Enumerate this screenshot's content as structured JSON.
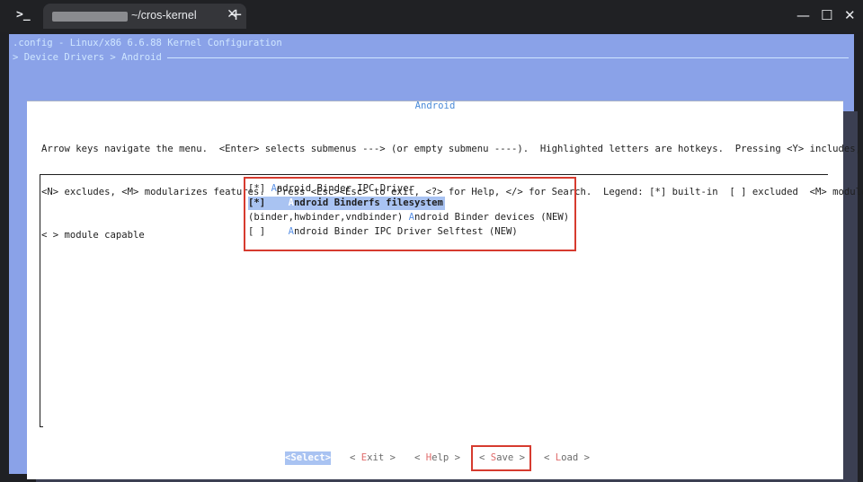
{
  "window": {
    "tab_title": "~/cros-kernel",
    "tab_close_glyph": "✕",
    "new_tab_glyph": "+",
    "prompt_glyph": ">_",
    "minimize_glyph": "—",
    "maximize_glyph": "☐",
    "close_glyph": "✕"
  },
  "header": {
    "config_line": ".config - Linux/x86 6.6.88 Kernel Configuration",
    "breadcrumb": "> Device Drivers > Android"
  },
  "dialog": {
    "title": "Android",
    "help_lines": [
      "Arrow keys navigate the menu.  <Enter> selects submenus ---> (or empty submenu ----).  Highlighted letters are hotkeys.  Pressing <Y> includes,",
      "<N> excludes, <M> modularizes features.  Press <Esc><Esc> to exit, <?> for Help, </> for Search.  Legend: [*] built-in  [ ] excluded  <M> module",
      "< > module capable"
    ]
  },
  "menu": {
    "items": [
      {
        "prefix": "[*] ",
        "hotkey": "A",
        "rest": "ndroid Binder IPC Driver",
        "selected": false
      },
      {
        "prefix": "[*]    ",
        "hotkey": "A",
        "rest": "ndroid Binderfs filesystem",
        "selected": true
      },
      {
        "prefix": "(binder,hwbinder,vndbinder) ",
        "hotkey": "A",
        "rest": "ndroid Binder devices (NEW)",
        "selected": false
      },
      {
        "prefix": "[ ]    ",
        "hotkey": "A",
        "rest": "ndroid Binder IPC Driver Selftest (NEW)",
        "selected": false
      }
    ]
  },
  "buttons": {
    "select": {
      "pre": "<",
      "hotkey": "S",
      "post": "elect>"
    },
    "exit": {
      "pre": "< ",
      "hotkey": "E",
      "post": "xit >"
    },
    "help": {
      "pre": "< ",
      "hotkey": "H",
      "post": "elp >"
    },
    "save": {
      "pre": "< ",
      "hotkey": "S",
      "post": "ave >"
    },
    "load": {
      "pre": "< ",
      "hotkey": "L",
      "post": "oad >"
    }
  },
  "colors": {
    "highlight_box": "#d63b2f",
    "hotkey": "#5e93e6",
    "selection": "#a9c3f2",
    "terminal_bg": "#8aa2e8"
  }
}
